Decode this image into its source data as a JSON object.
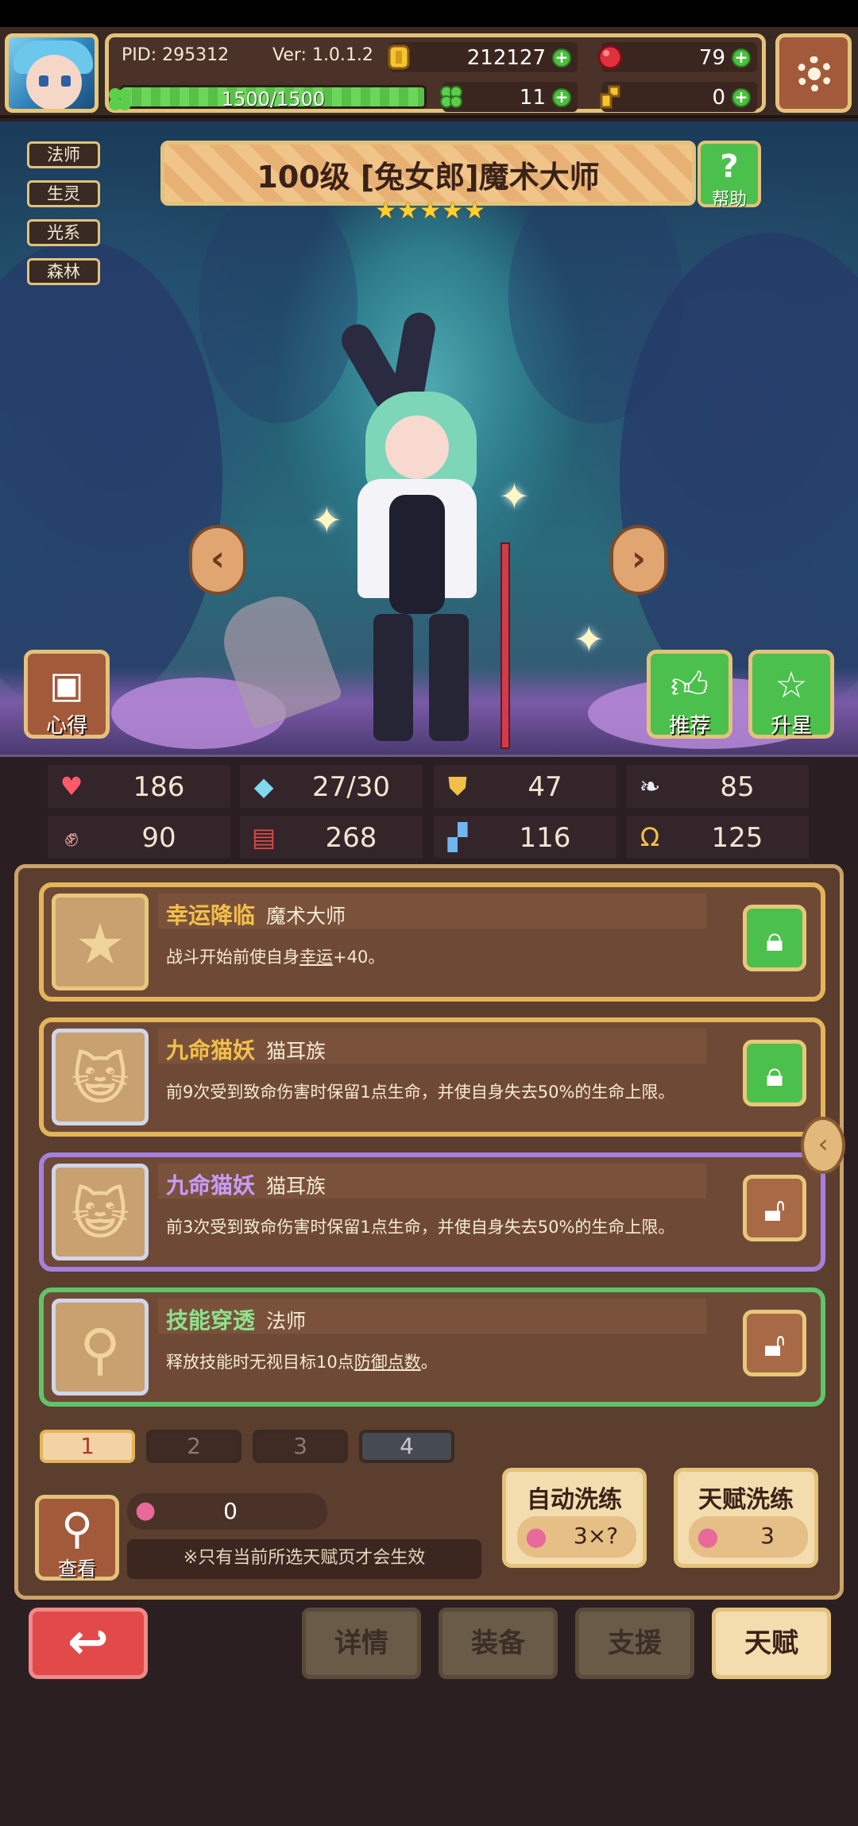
{
  "hud": {
    "pid": "PID: 295312",
    "version": "Ver: 1.0.1.2",
    "gold": "212127",
    "gems": "79",
    "clovers": "11",
    "keys": "0",
    "exp": "1500/1500",
    "exp_progress": 1.0
  },
  "tags": [
    "法师",
    "生灵",
    "光系",
    "森林"
  ],
  "title": "100级 [兔女郎]魔术大师",
  "stars": 5,
  "help_label": "帮助",
  "scene_buttons": {
    "insight": "心得",
    "recommend": "推荐",
    "star_up": "升星"
  },
  "stats": [
    {
      "icon": "heart-icon",
      "value": "186"
    },
    {
      "icon": "mana-drop-icon",
      "value": "27/30"
    },
    {
      "icon": "shield-icon",
      "value": "47"
    },
    {
      "icon": "wing-icon",
      "value": "85"
    },
    {
      "icon": "fist-icon",
      "value": "90"
    },
    {
      "icon": "book-icon",
      "value": "268"
    },
    {
      "icon": "boot-icon",
      "value": "116"
    },
    {
      "icon": "horseshoe-icon",
      "value": "125"
    }
  ],
  "talents": [
    {
      "name": "幸运降临",
      "source": "魔术大师",
      "desc_pre": "战斗开始前使自身",
      "desc_link": "幸运",
      "desc_post": "+40。",
      "locked": true
    },
    {
      "name": "九命猫妖",
      "source": "猫耳族",
      "desc_pre": "前9次受到致命伤害时保留1点生命，并使自身失去50%的生命上限。",
      "desc_link": "",
      "desc_post": "",
      "locked": true
    },
    {
      "name": "九命猫妖",
      "source": "猫耳族",
      "desc_pre": "前3次受到致命伤害时保留1点生命，并使自身失去50%的生命上限。",
      "desc_link": "",
      "desc_post": "",
      "locked": false
    },
    {
      "name": "技能穿透",
      "source": "法师",
      "desc_pre": "释放技能时无视目标10点",
      "desc_link": "防御点数",
      "desc_post": "。",
      "locked": false
    }
  ],
  "pages": [
    "1",
    "2",
    "3",
    "4"
  ],
  "look_label": "查看",
  "fruit_count": "0",
  "note": "※只有当前所选天赋页才会生效",
  "auto_wash": {
    "title": "自动洗练",
    "cost": "3×?"
  },
  "talent_wash": {
    "title": "天赋洗练",
    "cost": "3"
  },
  "bottom_tabs": {
    "details": "详情",
    "equipment": "装备",
    "support": "支援",
    "talent": "天赋"
  },
  "colors": {
    "gold_frame": "#e3c27a",
    "green_button": "#4cc04c",
    "red_back": "#e24a4a",
    "panel_brown": "#5b3e2e"
  }
}
